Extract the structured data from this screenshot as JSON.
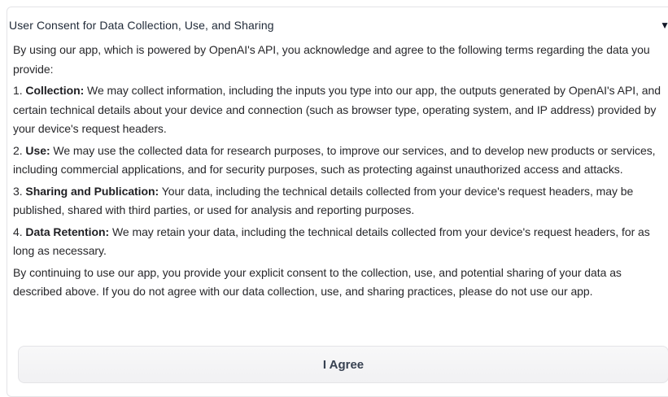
{
  "consent": {
    "title": "User Consent for Data Collection, Use, and Sharing",
    "toggle_icon": "▼",
    "intro": "By using our app, which is powered by OpenAI's API, you acknowledge and agree to the following terms regarding the data you provide:",
    "items": [
      {
        "prefix": "1. ",
        "heading": "Collection:",
        "text": " We may collect information, including the inputs you type into our app, the outputs generated by OpenAI's API, and certain technical details about your device and connection (such as browser type, operating system, and IP address) provided by your device's request headers."
      },
      {
        "prefix": "2. ",
        "heading": "Use:",
        "text": " We may use the collected data for research purposes, to improve our services, and to develop new products or services, including commercial applications, and for security purposes, such as protecting against unauthorized access and attacks."
      },
      {
        "prefix": "3. ",
        "heading": "Sharing and Publication:",
        "text": " Your data, including the technical details collected from your device's request headers, may be published, shared with third parties, or used for analysis and reporting purposes."
      },
      {
        "prefix": "4. ",
        "heading": "Data Retention:",
        "text": " We may retain your data, including the technical details collected from your device's request headers, for as long as necessary."
      }
    ],
    "closing": "By continuing to use our app, you provide your explicit consent to the collection, use, and potential sharing of your data as described above. If you do not agree with our data collection, use, and sharing practices, please do not use our app.",
    "agree_label": "I Agree"
  }
}
